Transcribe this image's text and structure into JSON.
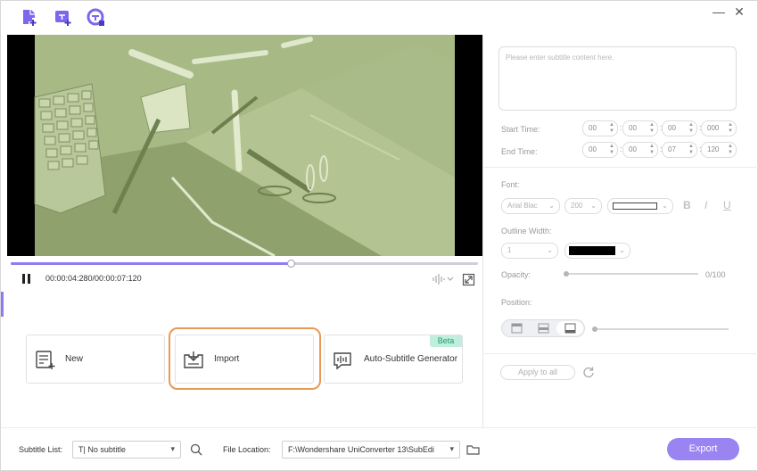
{
  "toolbar": {
    "icons": [
      "add-file-icon",
      "add-subtitle-icon",
      "subtitle-edit-icon"
    ]
  },
  "window": {
    "minimize_label": "—",
    "close_label": "✕"
  },
  "player": {
    "timecode": "00:00:04:280/00:00:07:120",
    "progress": 0.601
  },
  "options": {
    "new_label": "New",
    "import_label": "Import",
    "auto_label": "Auto-Subtitle Generator",
    "beta_label": "Beta"
  },
  "bottom": {
    "subtitle_list_label": "Subtitle List:",
    "subtitle_value": "No subtitle",
    "file_location_label": "File Location:",
    "file_location_value": "F:\\Wondershare UniConverter 13\\SubEdi",
    "export_label": "Export"
  },
  "editor": {
    "placeholder": "Please enter subtitle content here.",
    "start_time_label": "Start Time:",
    "end_time_label": "End Time:",
    "start_time": [
      "00",
      "00",
      "00",
      "000"
    ],
    "end_time": [
      "00",
      "00",
      "07",
      "120"
    ],
    "font_label": "Font:",
    "font_name": "Arial Blac",
    "font_size": "200",
    "font_color": "#ffffff",
    "bold_label": "B",
    "italic_label": "I",
    "underline_label": "U",
    "outline_label": "Outline Width:",
    "outline_value": "1",
    "outline_color": "#000000",
    "opacity_label": "Opacity:",
    "opacity_value": "0/100",
    "position_label": "Position:",
    "apply_label": "Apply to all"
  },
  "colors": {
    "accent": "#9a84f2",
    "highlight": "#e89a55",
    "beta_bg": "#bfeedd",
    "beta_text": "#1e9e70"
  }
}
